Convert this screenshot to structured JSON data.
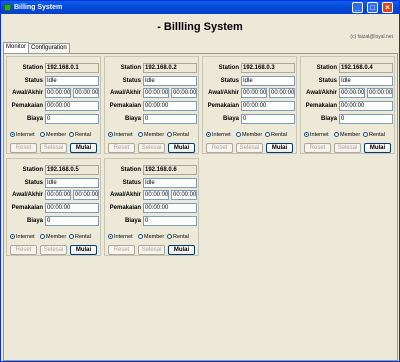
{
  "window": {
    "title": "Billing System",
    "icon": "app-icon"
  },
  "header": {
    "title": "- Billling System",
    "copyright": "(c) faizal@loyal.net"
  },
  "tabs": [
    {
      "label": "Monitor",
      "active": true
    },
    {
      "label": "Configuration",
      "active": false
    }
  ],
  "labels": {
    "station": "Station",
    "status": "Status",
    "awal_akhir": "Awal/Akhir",
    "pemakaian": "Pemakaian",
    "biaya": "Biaya",
    "internet": "Internet",
    "member": "Member",
    "rental": "Rental",
    "reset": "Reset",
    "selesai": "Selesai",
    "mulai": "Mulai"
  },
  "stations": [
    {
      "ip": "192.168.0.1",
      "status": "Idle",
      "awal": "00:00:00",
      "akhir": "00:00:00",
      "pemakaian": "00:00:00",
      "biaya": "0",
      "mode": "Internet"
    },
    {
      "ip": "192.168.0.2",
      "status": "Idle",
      "awal": "00:00:00",
      "akhir": "00:00:00",
      "pemakaian": "00:00:00",
      "biaya": "0",
      "mode": "Internet"
    },
    {
      "ip": "192.168.0.3",
      "status": "Idle",
      "awal": "00:00:00",
      "akhir": "00:00:00",
      "pemakaian": "00:00:00",
      "biaya": "0",
      "mode": "Internet"
    },
    {
      "ip": "192.168.0.4",
      "status": "Idle",
      "awal": "00:00:00",
      "akhir": "00:00:00",
      "pemakaian": "00:00:00",
      "biaya": "0",
      "mode": "Internet"
    },
    {
      "ip": "192.168.0.5",
      "status": "Idle",
      "awal": "00:00:00",
      "akhir": "00:00:00",
      "pemakaian": "00:00:00",
      "biaya": "0",
      "mode": "Internet"
    },
    {
      "ip": "192.168.0.6",
      "status": "Idle",
      "awal": "00:00:00",
      "akhir": "00:00:00",
      "pemakaian": "00:00:00",
      "biaya": "0",
      "mode": "Internet"
    }
  ]
}
